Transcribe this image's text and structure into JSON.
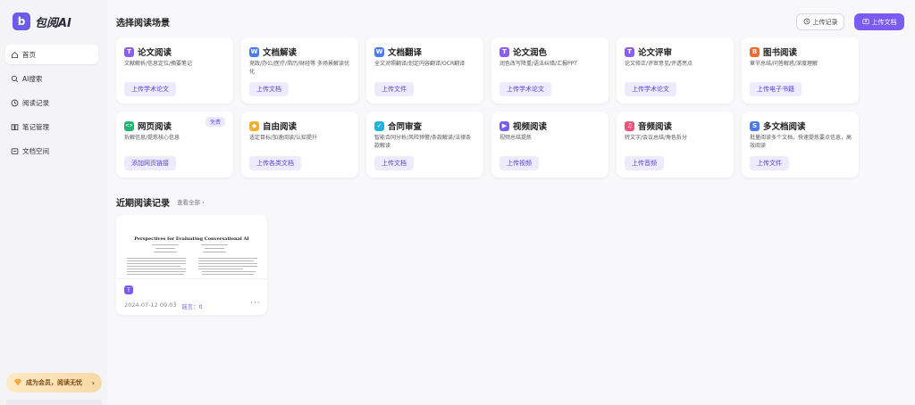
{
  "app": {
    "logo_letter": "b",
    "name": "包阅AI"
  },
  "sidebar": {
    "items": [
      {
        "label": "首页",
        "icon": "home-icon"
      },
      {
        "label": "AI搜索",
        "icon": "search-icon"
      },
      {
        "label": "阅读记录",
        "icon": "clock-icon"
      },
      {
        "label": "笔记管理",
        "icon": "book-icon"
      },
      {
        "label": "文档空间",
        "icon": "folder-icon"
      }
    ],
    "member_label": "成为会员，阅读无忧"
  },
  "header": {
    "section_title": "选择阅读场景",
    "history_label": "上传记录",
    "upload_label": "上传文档"
  },
  "scenes": [
    {
      "title": "论文阅读",
      "icon": "T",
      "color": "#8b5cf6",
      "desc": "文献解析/信息定位/摘要笔记",
      "button": "上传学术论文"
    },
    {
      "title": "文档解读",
      "icon": "W",
      "color": "#4a7cf0",
      "desc": "竞政/办公/医疗/简历/财经等 多场景解读优化",
      "button": "上传文档"
    },
    {
      "title": "文档翻译",
      "icon": "W",
      "color": "#4a7cf0",
      "desc": "全文对照翻译/划定内容翻译/OCR翻译",
      "button": "上传文件"
    },
    {
      "title": "论文润色",
      "icon": "T",
      "color": "#8b5cf6",
      "desc": "润色改写降重/语法纠错/汇报PPT",
      "button": "上传学术论文"
    },
    {
      "title": "论文评审",
      "icon": "T",
      "color": "#8b5cf6",
      "desc": "论文修正/评审意见/评透亮点",
      "button": "上传学术论文"
    },
    {
      "title": "图书阅读",
      "icon": "B",
      "color": "#f26a2e",
      "desc": "章节总结/问答解惑/深度理解",
      "button": "上传电子书籍"
    },
    {
      "title": "网页阅读",
      "icon": "<>",
      "color": "#22b573",
      "desc": "拆解信息/提炼核心信息",
      "button": "添加网页链接",
      "tag": "免费"
    },
    {
      "title": "自由阅读",
      "icon": "◆",
      "color": "#f3b028",
      "desc": "适定目标/加速阅读/认知提升",
      "button": "上传各类文档"
    },
    {
      "title": "合同审查",
      "icon": "✓",
      "color": "#1fb5d6",
      "desc": "智能合同分析/风险预警/条款解读/法律条款解读",
      "button": "上传文档"
    },
    {
      "title": "视频阅读",
      "icon": "▶",
      "color": "#7b5cf0",
      "desc": "视频总结提炼",
      "button": "上传视频"
    },
    {
      "title": "音频阅读",
      "icon": "♫",
      "color": "#f0527a",
      "desc": "转文字/会议总结/角色拆分",
      "button": "上传音频"
    },
    {
      "title": "多文档阅读",
      "icon": "S",
      "color": "#4a7cf0",
      "desc": "批量阅读多个文档，快速提炼要点信息，高效阅读",
      "button": "上传文件"
    }
  ],
  "recent": {
    "title": "近期阅读记录",
    "view_all": "查看全部 ›",
    "items": [
      {
        "thumb_title": "Perspectives for Evaluating Conversational AI",
        "badge": "T",
        "date": "2024-07-12 09:03",
        "tag": "谣言：0",
        "more": "···"
      }
    ]
  },
  "colors": {
    "accent": "#7b5cf0",
    "accent_light": "#eeebff",
    "background": "#f8f8fa"
  }
}
